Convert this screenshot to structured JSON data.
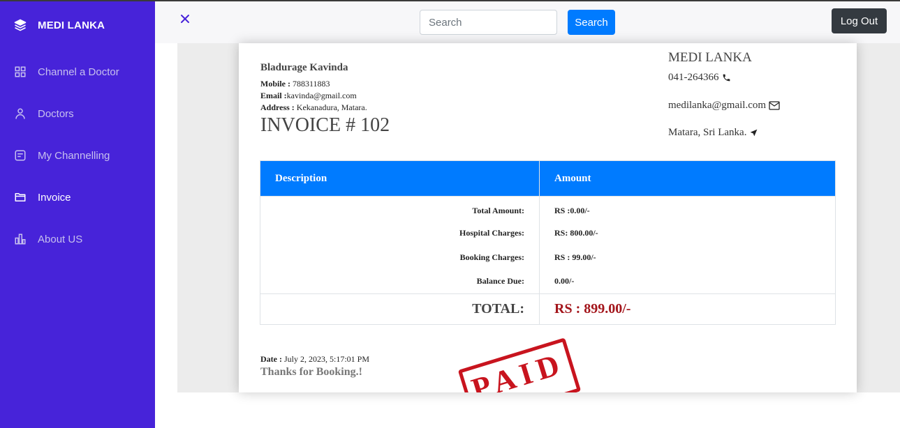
{
  "sidebar": {
    "brand": "MEDI LANKA",
    "items": [
      {
        "label": "Channel a Doctor",
        "icon": "grid-icon"
      },
      {
        "label": "Doctors",
        "icon": "user-icon"
      },
      {
        "label": "My Channelling",
        "icon": "message-square-icon"
      },
      {
        "label": "Invoice",
        "icon": "folder-icon",
        "active": true
      },
      {
        "label": "About US",
        "icon": "bar-chart-icon"
      }
    ]
  },
  "header": {
    "search_placeholder": "Search",
    "search_button": "Search",
    "logout_button": "Log Out"
  },
  "invoice": {
    "patient_name": "Bladurage Kavinda",
    "mobile_label": "Mobile :",
    "mobile": "788311883",
    "email_label": "Email :",
    "email": "kavinda@gmail.com",
    "address_label": "Address :",
    "address": "Kekanadura, Matara.",
    "invoice_number": "INVOICE # 102",
    "clinic": {
      "name": "MEDI LANKA",
      "phone": "041-264366",
      "email": "medilanka@gmail.com",
      "location": "Matara, Sri Lanka."
    },
    "table": {
      "headers": [
        "Description",
        "Amount"
      ],
      "rows": [
        {
          "label": "Total Amount:",
          "value": "RS :0.00/-"
        },
        {
          "label": "Hospital Charges:",
          "value": "RS: 800.00/-"
        },
        {
          "label": "Booking Charges:",
          "value": "RS : 99.00/-"
        },
        {
          "label": "Balance Due:",
          "value": "0.00/-"
        }
      ],
      "total_label": "TOTAL:",
      "total_value": "RS : 899.00/-"
    },
    "date_label": "Date :",
    "date": "July 2, 2023, 5:17:01 PM",
    "thanks": "Thanks for Booking.!",
    "stamp": "PAID"
  },
  "colors": {
    "sidebar": "#4723d9",
    "primary": "#007bff",
    "dark_button": "#343a40",
    "total_red": "#a3151b",
    "stamp_red": "#c8141e"
  }
}
